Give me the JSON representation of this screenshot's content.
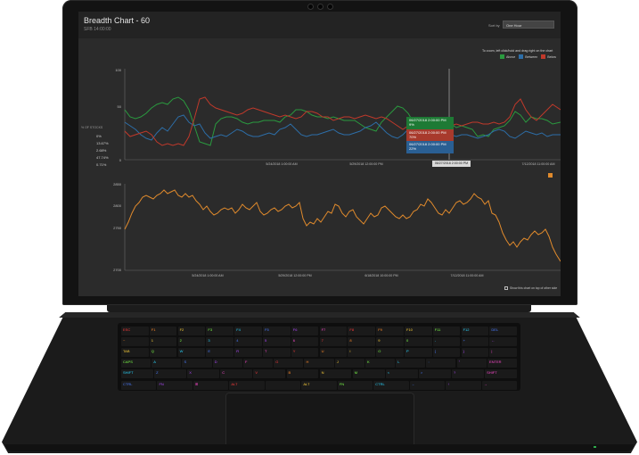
{
  "app": {
    "title": "Breadth Chart - 60",
    "subtitle": "SFB 14:00:00",
    "sort_label": "Sort by",
    "sort_value": "One Hour"
  },
  "hint": "To zoom, left click/hold and drag right on the chart",
  "legend": [
    {
      "label": "Above",
      "color": "#2a9a3f"
    },
    {
      "label": "Between",
      "color": "#2d6ea8"
    },
    {
      "label": "Below",
      "color": "#c0392b"
    }
  ],
  "side_panel": {
    "title": "% OF STOCKS",
    "values": [
      "0%",
      "13.67%",
      "2.68%",
      "47.74%",
      "0.71%"
    ]
  },
  "tooltips": {
    "green": {
      "date": "06/27/2018 2:00:00 PM",
      "value": "9%"
    },
    "red": {
      "date": "06/27/2018 2:00:00 PM",
      "value": "70%"
    },
    "blue": {
      "date": "06/27/2018 2:00:00 PM",
      "value": "22%"
    }
  },
  "cursor_date": "06/27/2018 2:00:00 PM",
  "upper_chart": {
    "y_ticks": [
      "100",
      "50",
      "0"
    ],
    "x_ticks": [
      "5/24/2018 1:00:00 AM",
      "5/29/2018 12:00:00 PM",
      "6/18/2018 10:00:00 PM",
      "7/12/2018 11:00:00 AM"
    ]
  },
  "lower_chart": {
    "y_ticks": [
      "2850",
      "2800",
      "2750",
      "2700"
    ],
    "x_ticks": [
      "5/24/2018 1:00:00 AM",
      "5/29/2018 12:00:00 PM",
      "6/18/2018 10:00:00 PM",
      "7/12/2018 11:00:00 AM"
    ]
  },
  "checkbox_label": "Show this chart on top of other side",
  "keyboard": {
    "rows": [
      [
        "ESC",
        "F1",
        "F2",
        "F3",
        "F4",
        "F5",
        "F6",
        "F7",
        "F8",
        "F9",
        "F10",
        "F11",
        "F12",
        "DEL"
      ],
      [
        "~",
        "1",
        "2",
        "3",
        "4",
        "5",
        "6",
        "7",
        "8",
        "9",
        "0",
        "-",
        "+",
        "←"
      ],
      [
        "TAB",
        "Q",
        "W",
        "E",
        "R",
        "T",
        "Y",
        "U",
        "I",
        "O",
        "P",
        "{",
        "}",
        "|"
      ],
      [
        "CAPS",
        "A",
        "S",
        "D",
        "F",
        "G",
        "H",
        "J",
        "K",
        "L",
        ":",
        "\"",
        "ENTER"
      ],
      [
        "SHIFT",
        "Z",
        "X",
        "C",
        "V",
        "B",
        "N",
        "M",
        "<",
        ">",
        "?",
        "SHIFT"
      ],
      [
        "CTRL",
        "FN",
        "⊞",
        "ALT",
        "",
        "ALT",
        "FN",
        "CTRL",
        "←",
        "↑",
        "→"
      ]
    ],
    "colors": [
      "#ff3b3b",
      "#ff8a2a",
      "#ffd23a",
      "#7cff4a",
      "#2ad6ff",
      "#4a7bff",
      "#b04aff",
      "#ff4ad0"
    ]
  }
}
